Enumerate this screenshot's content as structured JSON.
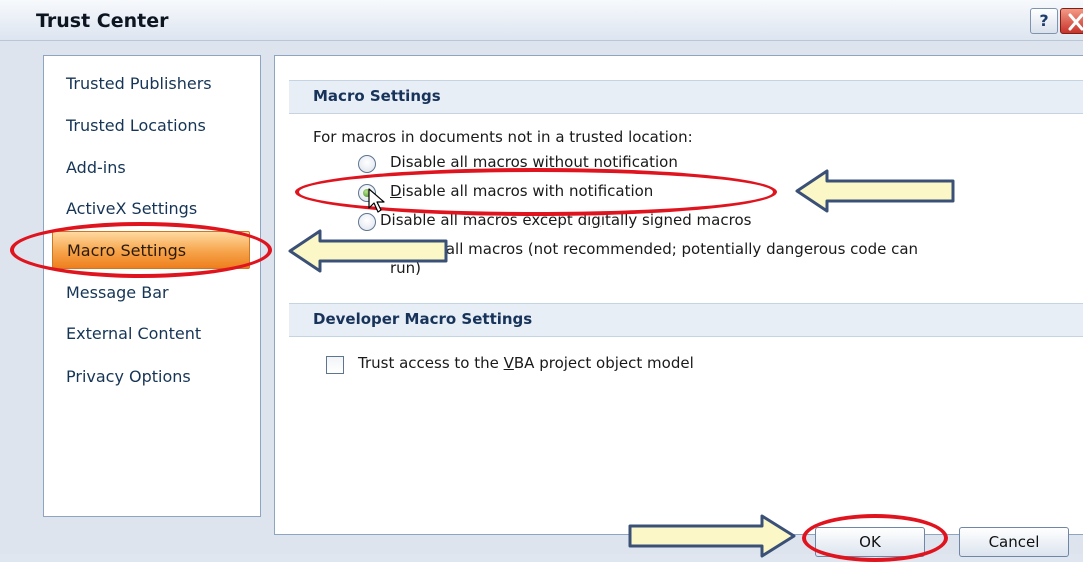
{
  "window": {
    "title": "Trust Center",
    "help_label": "?"
  },
  "sidebar": {
    "items": [
      {
        "label": "Trusted Publishers"
      },
      {
        "label": "Trusted Locations"
      },
      {
        "label": "Add-ins"
      },
      {
        "label": "ActiveX Settings"
      },
      {
        "label": "Macro Settings",
        "selected": true
      },
      {
        "label": "Message Bar"
      },
      {
        "label": "External Content"
      },
      {
        "label": "Privacy Options"
      }
    ]
  },
  "macro_settings": {
    "header": "Macro Settings",
    "intro": "For macros in documents not in a trusted location:",
    "options": [
      {
        "pre": "",
        "key": "",
        "post": "Disable all macros without notification",
        "checked": false
      },
      {
        "pre": "",
        "key": "D",
        "post": "isable all macros with notification",
        "checked": true
      },
      {
        "pre": "Disable all macros except di",
        "key": "g",
        "post": "itally signed macros",
        "checked": false
      },
      {
        "pre": "",
        "key": "E",
        "post": "nable all macros (not recommended; potentially dangerous code can",
        "line2": "run)",
        "checked": false
      }
    ]
  },
  "developer": {
    "header": "Developer Macro Settings",
    "checkbox_pre": "Trust access to the ",
    "checkbox_key": "V",
    "checkbox_post": "BA project object model",
    "checked": false
  },
  "buttons": {
    "ok": "OK",
    "cancel": "Cancel"
  },
  "annotations": {
    "highlight_color": "#e0141e",
    "arrow_fill": "#fbf7c6",
    "arrow_stroke": "#3a5077"
  },
  "colors": {
    "selected_nav": "#f6a34a",
    "section_header_bg": "#e8eef6",
    "accent_text": "#17335a"
  }
}
